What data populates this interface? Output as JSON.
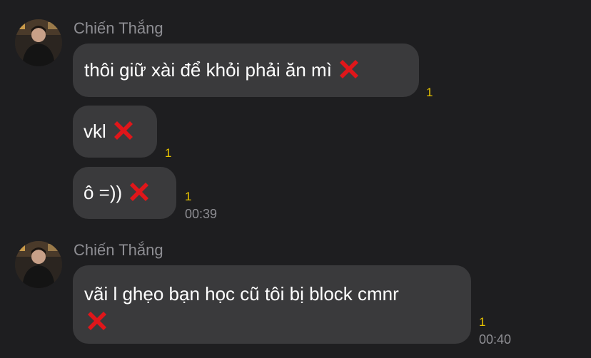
{
  "colors": {
    "background": "#1e1e20",
    "bubble": "#3a3a3c",
    "sender_name": "#8e8e93",
    "reaction_count": "#e8c400",
    "timestamp": "#8e8e93",
    "reaction_icon": "#e0161a"
  },
  "groups": [
    {
      "sender": "Chiến Thắng",
      "avatar": "avatar-photo",
      "messages": [
        {
          "text": "thôi giữ xài để khỏi phải ăn mì",
          "reaction_icon": "cross-mark-icon",
          "reaction_count": "1"
        },
        {
          "text": "vkl",
          "reaction_icon": "cross-mark-icon",
          "reaction_count": "1"
        },
        {
          "text": "ô =))",
          "reaction_icon": "cross-mark-icon",
          "reaction_count": "1",
          "time": "00:39"
        }
      ]
    },
    {
      "sender": "Chiến Thắng",
      "avatar": "avatar-photo",
      "messages": [
        {
          "text_line1": "vãi l ghẹo bạn học cũ tôi bị block cmnr",
          "reaction_icon": "cross-mark-icon",
          "reaction_count": "1",
          "time": "00:40"
        }
      ]
    }
  ]
}
